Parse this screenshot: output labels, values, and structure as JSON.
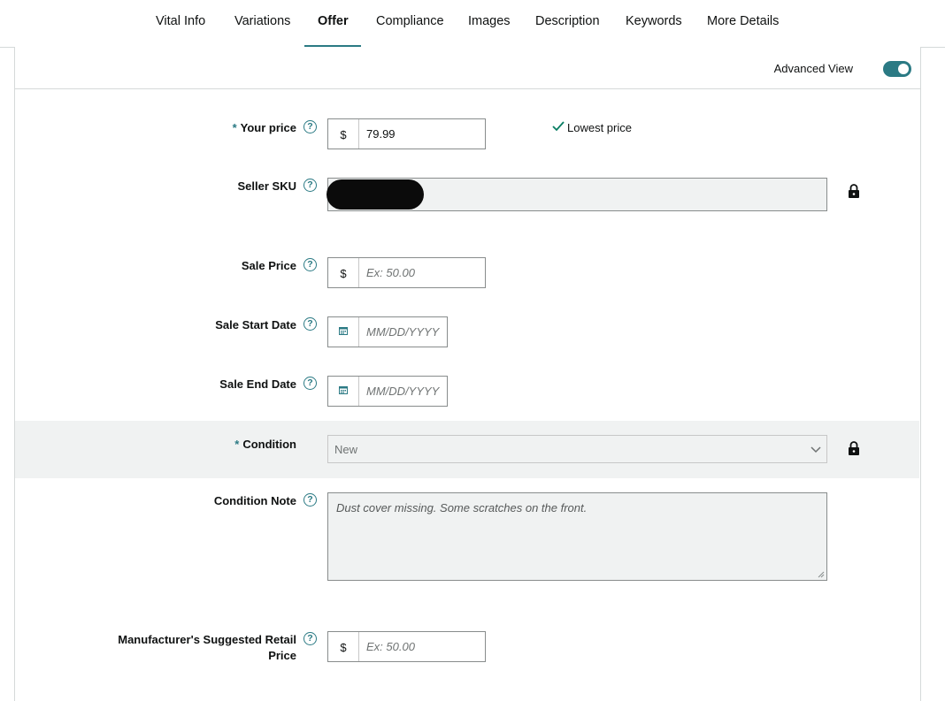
{
  "tabs": [
    {
      "label": "Vital Info",
      "active": false
    },
    {
      "label": "Variations",
      "active": false
    },
    {
      "label": "Offer",
      "active": true
    },
    {
      "label": "Compliance",
      "active": false
    },
    {
      "label": "Images",
      "active": false
    },
    {
      "label": "Description",
      "active": false
    },
    {
      "label": "Keywords",
      "active": false
    },
    {
      "label": "More Details",
      "active": false
    }
  ],
  "advanced_view": {
    "label": "Advanced View",
    "enabled": true
  },
  "form": {
    "your_price": {
      "required_mark": "*",
      "label": "Your price",
      "currency": "$",
      "value": "79.99",
      "status": "Lowest price"
    },
    "seller_sku": {
      "label": "Seller SKU",
      "locked": true
    },
    "sale_price": {
      "label": "Sale Price",
      "currency": "$",
      "placeholder": "Ex: 50.00"
    },
    "sale_start_date": {
      "label": "Sale Start Date",
      "placeholder": "MM/DD/YYYY"
    },
    "sale_end_date": {
      "label": "Sale End Date",
      "placeholder": "MM/DD/YYYY"
    },
    "condition": {
      "required_mark": "*",
      "label": "Condition",
      "value": "New",
      "locked": true
    },
    "condition_note": {
      "label": "Condition Note",
      "value": "Dust cover missing. Some scratches on the front."
    },
    "msrp": {
      "label_line1": "Manufacturer's Suggested Retail",
      "label_line2": "Price",
      "currency": "$",
      "placeholder": "Ex: 50.00"
    }
  },
  "colors": {
    "accent": "#2b7a84",
    "border": "#888c8c",
    "band": "#f0f2f2",
    "success": "#067d62"
  }
}
